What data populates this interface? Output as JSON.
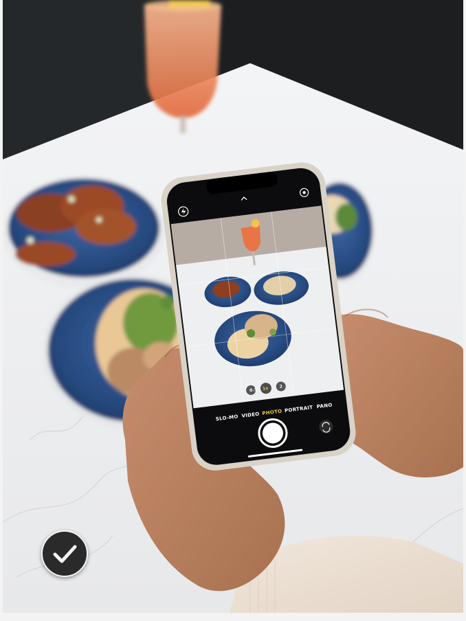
{
  "camera_ui": {
    "modes": [
      "SLO-MO",
      "VIDEO",
      "PHOTO",
      "PORTRAIT",
      "PANO"
    ],
    "active_mode": "PHOTO",
    "zoom_options": [
      "0.5",
      "1x",
      "2"
    ],
    "active_zoom": "1x"
  },
  "icons": {
    "flash": "flash-icon",
    "live_photo": "live-photo-icon",
    "chevron": "chevron-up-icon",
    "flip": "camera-flip-icon",
    "shutter": "shutter-button",
    "check": "checkmark-icon"
  },
  "colors": {
    "accent_mode": "#f7c948",
    "plate_blue": "#2c4f86",
    "table": "#eceef0",
    "phone_case": "#d9d2c7",
    "badge": "#2a2a2a"
  }
}
